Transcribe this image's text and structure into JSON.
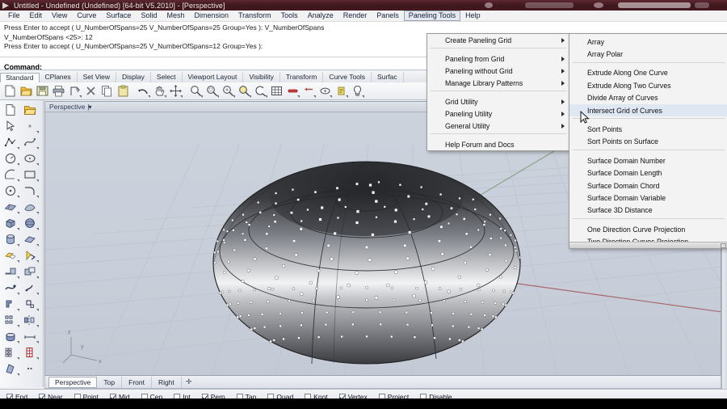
{
  "titlebar": {
    "title": "Untitled - Undefined (Undefined) [64-bit V5.2010] - [Perspective]",
    "icon": "rhino-logo-icon"
  },
  "menubar": {
    "items": [
      {
        "label": "File",
        "active": false
      },
      {
        "label": "Edit",
        "active": false
      },
      {
        "label": "View",
        "active": false
      },
      {
        "label": "Curve",
        "active": false
      },
      {
        "label": "Surface",
        "active": false
      },
      {
        "label": "Solid",
        "active": false
      },
      {
        "label": "Mesh",
        "active": false
      },
      {
        "label": "Dimension",
        "active": false
      },
      {
        "label": "Transform",
        "active": false
      },
      {
        "label": "Tools",
        "active": false
      },
      {
        "label": "Analyze",
        "active": false
      },
      {
        "label": "Render",
        "active": false
      },
      {
        "label": "Panels",
        "active": false
      },
      {
        "label": "Paneling Tools",
        "active": true
      },
      {
        "label": "Help",
        "active": false
      }
    ]
  },
  "command_history": {
    "lines": [
      "Press Enter to accept ( U_NumberOfSpans=25  V_NumberOfSpans=25  Group=Yes ): V_NumberOfSpans",
      "V_NumberOfSpans <25>: 12",
      "Press Enter to accept ( U_NumberOfSpans=25  V_NumberOfSpans=12  Group=Yes ):"
    ],
    "prompt_label": "Command:",
    "prompt_value": ""
  },
  "toolbar_tabs": {
    "items": [
      {
        "label": "Standard",
        "selected": true
      },
      {
        "label": "CPlanes",
        "selected": false
      },
      {
        "label": "Set View",
        "selected": false
      },
      {
        "label": "Display",
        "selected": false
      },
      {
        "label": "Select",
        "selected": false
      },
      {
        "label": "Viewport Layout",
        "selected": false
      },
      {
        "label": "Visibility",
        "selected": false
      },
      {
        "label": "Transform",
        "selected": false
      },
      {
        "label": "Curve Tools",
        "selected": false
      },
      {
        "label": "Surfac",
        "selected": false
      }
    ]
  },
  "top_toolbar": {
    "buttons": [
      {
        "name": "new-file-icon"
      },
      {
        "name": "open-folder-icon"
      },
      {
        "name": "save-icon"
      },
      {
        "name": "print-icon"
      },
      {
        "name": "cut-icon"
      },
      {
        "name": "delete-x-icon"
      },
      {
        "name": "copy-icon"
      },
      {
        "name": "paste-icon"
      },
      {
        "name": "undo-icon"
      },
      {
        "name": "pan-hand-icon"
      },
      {
        "name": "move-icon"
      },
      {
        "name": "zoom-icon"
      },
      {
        "name": "zoom-window-icon"
      },
      {
        "name": "zoom-selected-icon"
      },
      {
        "name": "zoom-extents-icon"
      },
      {
        "name": "zoom-dynamic-icon"
      },
      {
        "name": "grid-snap-icon"
      },
      {
        "name": "ortho-icon"
      },
      {
        "name": "planar-icon"
      },
      {
        "name": "osnap-icon"
      },
      {
        "name": "record-history-icon"
      },
      {
        "name": "layers-icon"
      },
      {
        "name": "light-bulb-icon"
      }
    ]
  },
  "left_toolbar": {
    "buttons": [
      {
        "name": "new-file-icon"
      },
      {
        "name": "open-folder-icon"
      },
      {
        "name": "select-arrow-icon"
      },
      {
        "name": "point-icon"
      },
      {
        "name": "polyline-icon"
      },
      {
        "name": "control-point-curve-icon"
      },
      {
        "name": "circle-icon"
      },
      {
        "name": "ellipse-icon"
      },
      {
        "name": "arc-icon"
      },
      {
        "name": "rectangle-icon"
      },
      {
        "name": "curve-from-points-icon"
      },
      {
        "name": "fillet-curve-icon"
      },
      {
        "name": "surface-from-points-icon"
      },
      {
        "name": "loft-surface-icon"
      },
      {
        "name": "box-solid-icon"
      },
      {
        "name": "sphere-solid-icon"
      },
      {
        "name": "cylinder-icon"
      },
      {
        "name": "pipe-icon"
      },
      {
        "name": "extrude-solid-icon"
      },
      {
        "name": "revolve-surface-icon"
      },
      {
        "name": "boolean-union-icon"
      },
      {
        "name": "boolean-difference-icon"
      },
      {
        "name": "trim-icon"
      },
      {
        "name": "split-icon"
      },
      {
        "name": "mesh-from-surface-icon"
      },
      {
        "name": "mesh-edit-icon"
      },
      {
        "name": "fillet-edge-icon"
      },
      {
        "name": "blend-surface-icon"
      },
      {
        "name": "text-object-icon"
      },
      {
        "name": "point-edit-icon"
      },
      {
        "name": "array-icon"
      },
      {
        "name": "mirror-icon"
      },
      {
        "name": "cap-holes-icon"
      },
      {
        "name": "dimension-icon"
      },
      {
        "name": "layers-panel-icon"
      },
      {
        "name": "properties-panel-icon"
      },
      {
        "name": "render-icon"
      },
      {
        "name": "options-icon"
      }
    ]
  },
  "viewport": {
    "label": "Perspective",
    "caret": "caret-down-icon",
    "axis": {
      "x": "x",
      "y": "y",
      "z": "z"
    },
    "background_color": "#c9cfda",
    "grid_color": "#bcc3cf",
    "x_axis_color": "#a36a72",
    "y_axis_color": "#86a080",
    "model": {
      "name": "paneled-ellipsoid",
      "point_color": "#ffffff",
      "u_spans": 25,
      "v_spans": 12
    }
  },
  "viewport_tabs": {
    "items": [
      {
        "label": "Perspective",
        "selected": true
      },
      {
        "label": "Top",
        "selected": false
      },
      {
        "label": "Front",
        "selected": false
      },
      {
        "label": "Right",
        "selected": false
      }
    ],
    "add_label": "✛"
  },
  "paneling_menu": {
    "name": "paneling-tools-menu",
    "items": [
      {
        "label": "Create Paneling Grid",
        "submenu": true
      },
      {
        "type": "separator"
      },
      {
        "label": "Paneling from Grid",
        "submenu": true
      },
      {
        "label": "Paneling without Grid",
        "submenu": true
      },
      {
        "label": "Manage Library Patterns",
        "submenu": true
      },
      {
        "type": "separator"
      },
      {
        "label": "Grid Utility",
        "submenu": true
      },
      {
        "label": "Paneling Utility",
        "submenu": true
      },
      {
        "label": "General Utility",
        "submenu": true
      },
      {
        "type": "separator"
      },
      {
        "label": "Help Forum and Docs",
        "submenu": false
      }
    ]
  },
  "general_utility_submenu": {
    "name": "general-utility-submenu",
    "items": [
      {
        "label": "Array"
      },
      {
        "label": "Array Polar"
      },
      {
        "type": "separator"
      },
      {
        "label": "Extrude Along One Curve"
      },
      {
        "label": "Extrude Along Two Curves"
      },
      {
        "label": "Divide Array of Curves"
      },
      {
        "label": "Intersect Grid of Curves"
      },
      {
        "type": "separator"
      },
      {
        "label": "Sort Points"
      },
      {
        "label": "Sort Points on Surface"
      },
      {
        "type": "separator"
      },
      {
        "label": "Surface Domain Number"
      },
      {
        "label": "Surface Domain Length"
      },
      {
        "label": "Surface Domain Chord"
      },
      {
        "label": "Surface Domain Variable"
      },
      {
        "label": "Surface 3D Distance"
      },
      {
        "type": "separator"
      },
      {
        "label": "One Direction Curve Projection"
      },
      {
        "label": "Two Direction Curves Projection"
      }
    ]
  },
  "osnap": {
    "items": [
      {
        "label": "End",
        "checked": true
      },
      {
        "label": "Near",
        "checked": true
      },
      {
        "label": "Point",
        "checked": false
      },
      {
        "label": "Mid",
        "checked": true
      },
      {
        "label": "Cen",
        "checked": false
      },
      {
        "label": "Int",
        "checked": false
      },
      {
        "label": "Perp",
        "checked": true
      },
      {
        "label": "Tan",
        "checked": false
      },
      {
        "label": "Quad",
        "checked": false
      },
      {
        "label": "Knot",
        "checked": false
      },
      {
        "label": "Vertex",
        "checked": true
      },
      {
        "label": "Project",
        "checked": false
      },
      {
        "label": "Disable",
        "checked": false
      }
    ]
  },
  "cursor": {
    "name": "mouse-pointer-icon"
  }
}
